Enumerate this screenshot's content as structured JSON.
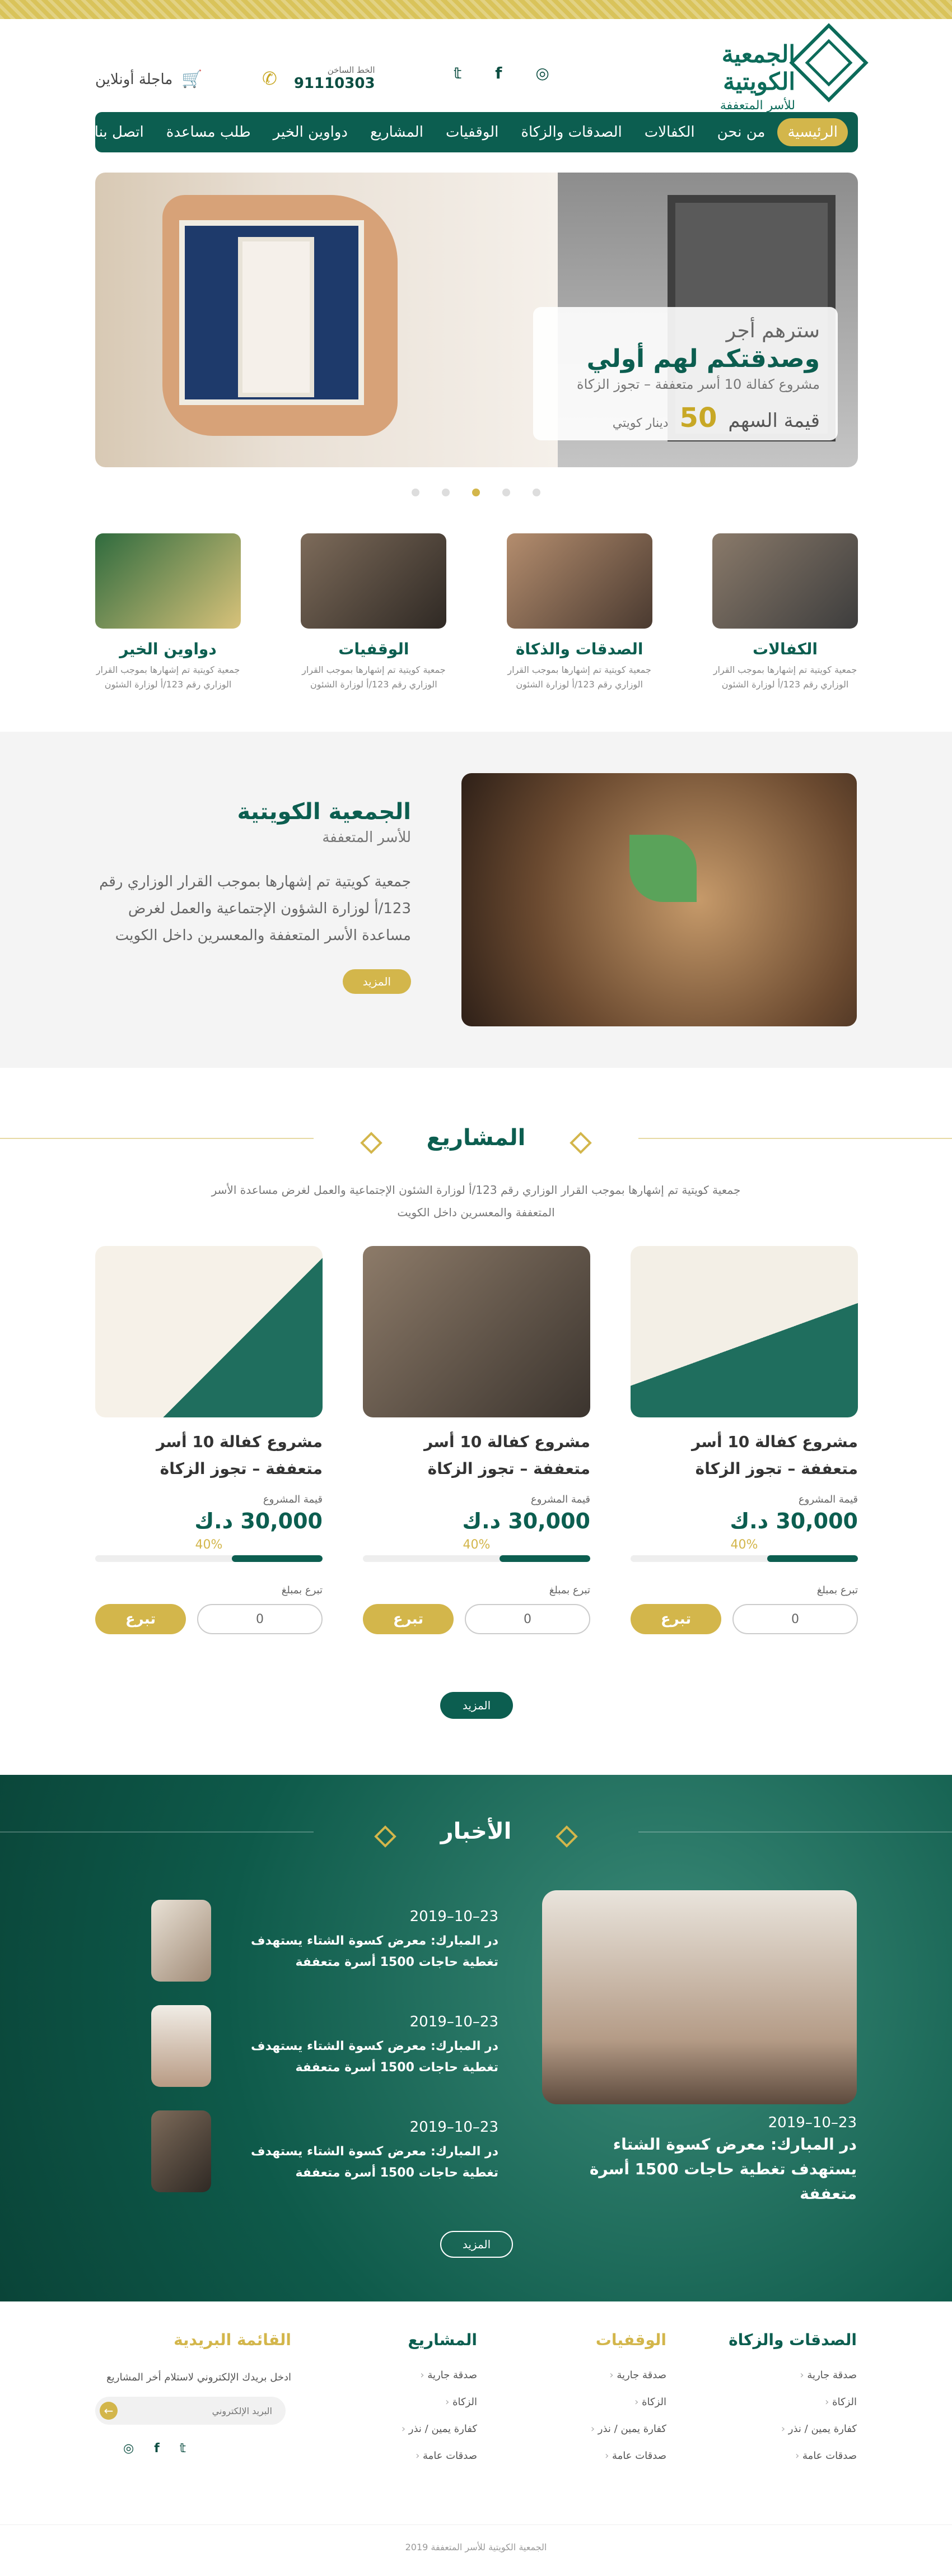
{
  "header": {
    "logo_title": "الجمعية الكويتية",
    "logo_sub": "للأسر المتعففة",
    "social": [
      "ig",
      "f",
      "t"
    ],
    "hotline_label": "الخط الساخن",
    "hotline": "91110303",
    "shop_label": "ماجلة أونلاين"
  },
  "nav": [
    "الرئيسية",
    "من نحن",
    "الكفالات",
    "الصدقات والزكاة",
    "الوقفيات",
    "المشاريع",
    "دواوين الخير",
    "طلب مساعدة",
    "اتصل بنا"
  ],
  "hero": {
    "l1": "سترهم أجر",
    "l2": "وصدقتكم لهم أولي",
    "l3": "مشروع كفالة 10 أسر متعففة – تجوز الزكاة",
    "price_label": "قيمة السهم",
    "price": "50",
    "unit": "دينار كويتي"
  },
  "categories": [
    {
      "title": "الكفالات",
      "desc": "جمعية كويتية تم إشهارها بموجب القرار الوزاري رقم 123/أ لوزارة الشئون"
    },
    {
      "title": "الصدقات والذكاة",
      "desc": "جمعية كويتية تم إشهارها بموجب القرار الوزاري رقم 123/أ لوزارة الشئون"
    },
    {
      "title": "الوقفيات",
      "desc": "جمعية كويتية تم إشهارها بموجب القرار الوزاري رقم 123/أ لوزارة الشئون"
    },
    {
      "title": "دواوين الخير",
      "desc": "جمعية كويتية تم إشهارها بموجب القرار الوزاري رقم 123/أ لوزارة الشئون"
    }
  ],
  "about": {
    "title": "الجمعية الكويتية",
    "sub": "للأسر المتعففة",
    "body": "جمعية كويتية تم إشهارها بموجب القرار الوزاري رقم 123/أ لوزارة الشؤون الإجتماعية والعمل لغرض مساعدة الأسر المتعففة والمعسرين داخل الكويت",
    "more": "المزيد"
  },
  "projects_section": {
    "title": "المشاريع",
    "intro_1": "جمعية كويتية تم إشهارها بموجب القرار الوزاري رقم 123/أ لوزارة الشئون الإجتماعية والعمل لغرض مساعدة الأسر",
    "intro_2": "المتعففة والمعسرين داخل الكويت",
    "more": "المزيد"
  },
  "projects": [
    {
      "title": "مشروع كفالة 10 أسر متعففة – تجوز الزكاة",
      "value_label": "قيمة المشروع",
      "value": "30,000 د.ك",
      "progress": "40%",
      "donate_label": "تبرع بمبلغ",
      "amount": "0",
      "donate_btn": "تبرع",
      "color_a": "#1f6e5e",
      "color_b": "#e9e2d2"
    },
    {
      "title": "مشروع كفالة 10 أسر متعففة – تجوز الزكاة",
      "value_label": "قيمة المشروع",
      "value": "30,000 د.ك",
      "progress": "40%",
      "donate_label": "تبرع بمبلغ",
      "amount": "0",
      "donate_btn": "تبرع",
      "color_a": "#6f6256",
      "color_b": "#3b342e"
    },
    {
      "title": "مشروع كفالة 10 أسر متعففة – تجوز الزكاة",
      "value_label": "قيمة المشروع",
      "value": "30,000 د.ك",
      "progress": "40%",
      "donate_label": "تبرع بمبلغ",
      "amount": "0",
      "donate_btn": "تبرع",
      "color_a": "#f3efe8",
      "color_b": "#c9302c"
    }
  ],
  "news_section": {
    "title": "الأخبار",
    "more": "المزيد"
  },
  "featured": {
    "date": "23–10–2019",
    "title": "در المبارك: معرض كسوة الشتاء يستهدف تغطية حاجات 1500 أسرة متعففة"
  },
  "news": [
    {
      "date": "23–10–2019",
      "title": "در المبارك: معرض كسوة الشتاء يستهدف تغطية حاجات 1500 أسرة متعففة"
    },
    {
      "date": "23–10–2019",
      "title": "در المبارك: معرض كسوة الشتاء يستهدف تغطية حاجات 1500 أسرة متعففة"
    },
    {
      "date": "23–10–2019",
      "title": "در المبارك: معرض كسوة الشتاء يستهدف تغطية حاجات 1500 أسرة متعففة"
    }
  ],
  "footer": {
    "col1": {
      "title": "الصدقات والزكاة",
      "items": [
        "صدقة جارية",
        "الزكاة",
        "كفارة يمين / نذر",
        "صدقات عامة"
      ]
    },
    "col2": {
      "title": "الوقفيات",
      "items": [
        "صدقة جارية",
        "الزكاة",
        "كفارة يمين / نذر",
        "صدقات عامة"
      ]
    },
    "col3": {
      "title": "المشاريع",
      "items": [
        "صدقة جارية",
        "الزكاة",
        "كفارة يمين / نذر",
        "صدقات عامة"
      ]
    },
    "newsletter": {
      "title": "القائمة البريدية",
      "text": "ادخل بريدك الإلكتروني لاستلام أخر المشاريع",
      "placeholder": "البريد الإلكتروني"
    },
    "copyright": "الجمعية الكويتية للأسر المتعففة 2019"
  },
  "colors": {
    "primary": "#0c5e50",
    "accent": "#d3b64b"
  }
}
